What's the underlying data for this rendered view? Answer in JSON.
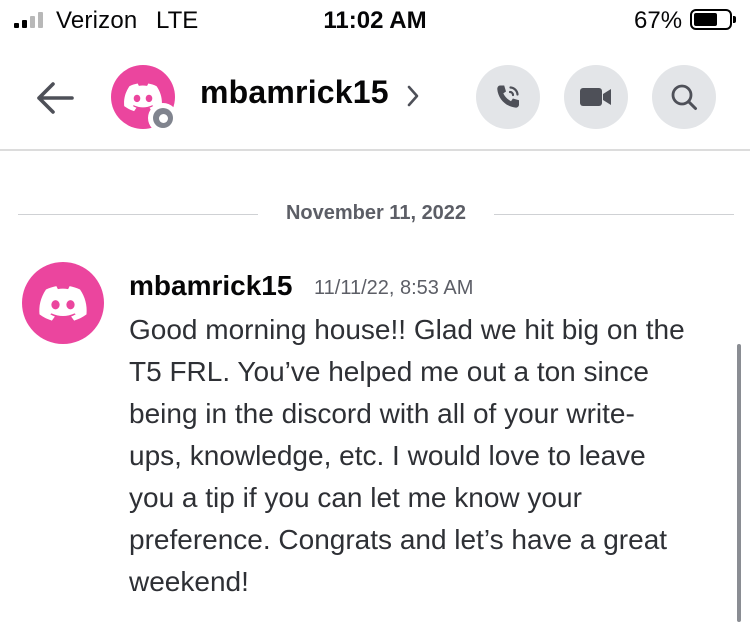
{
  "status_bar": {
    "carrier": "Verizon",
    "network": "LTE",
    "time": "11:02 AM",
    "battery_percent": "67%",
    "battery_level": 0.67,
    "signal_bars": 2
  },
  "header": {
    "username": "mbamrick15",
    "status": "offline",
    "buttons": {
      "call": "phone-call-icon",
      "video": "video-camera-icon",
      "search": "search-icon"
    }
  },
  "date_divider": "November 11, 2022",
  "message": {
    "author": "mbamrick15",
    "timestamp": "11/11/22, 8:53 AM",
    "lines": [
      "Good morning house!! Glad we hit big on the",
      "T5 FRL. You’ve helped me out a ton since",
      "being in the discord with all of your write-",
      "ups, knowledge, etc. I would love to leave",
      "you a tip if you can let me know your",
      "preference. Congrats and let’s have a great",
      "weekend!"
    ]
  },
  "colors": {
    "avatar": "#eb459e",
    "button_bg": "#e3e5e8",
    "muted_text": "#5c5e66"
  }
}
